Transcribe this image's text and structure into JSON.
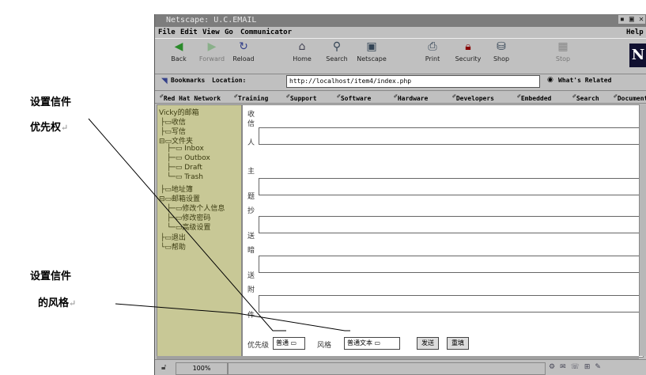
{
  "annotations": [
    {
      "line1": "设置信件",
      "line2": "优先权"
    },
    {
      "line1": "设置信件",
      "line2": "的风格"
    }
  ],
  "annotation_mark": "↵",
  "window": {
    "title": "Netscape: U.C.EMAIL",
    "menu": [
      "File",
      "Edit",
      "View",
      "Go",
      "Communicator"
    ],
    "menu_right": "Help"
  },
  "toolbar": [
    {
      "icon": "back-icon",
      "label": "Back"
    },
    {
      "icon": "forward-icon",
      "label": "Forward"
    },
    {
      "icon": "reload-icon",
      "label": "Reload"
    },
    {
      "icon": "home-icon",
      "label": "Home"
    },
    {
      "icon": "search-icon",
      "label": "Search"
    },
    {
      "icon": "netscape-icon",
      "label": "Netscape"
    },
    {
      "icon": "print-icon",
      "label": "Print"
    },
    {
      "icon": "security-icon",
      "label": "Security"
    },
    {
      "icon": "shop-icon",
      "label": "Shop"
    },
    {
      "icon": "stop-icon",
      "label": "Stop"
    }
  ],
  "location": {
    "bookmarks_label": "Bookmarks",
    "location_label": "Location:",
    "url": "http://localhost/item4/index.php",
    "related_label": "What's Related"
  },
  "personal_bar": [
    "Red Hat Network",
    "Training",
    "Support",
    "Software",
    "Hardware",
    "Developers",
    "Embedded",
    "Search",
    "Documentation"
  ],
  "tree": [
    "Vicky的邮箱",
    "收信",
    "写信",
    "文件夹",
    "Inbox",
    "Outbox",
    "Draft",
    "Trash",
    "地址簿",
    "邮箱设置",
    "修改个人信息",
    "修改密码",
    "高级设置",
    "退出",
    "帮助"
  ],
  "form": {
    "recipient_label": [
      "收",
      "信",
      "人"
    ],
    "subject_label": [
      "主",
      "题"
    ],
    "cc_label": [
      "抄",
      "送"
    ],
    "bcc_label": [
      "暗",
      "送"
    ],
    "attach_label": [
      "附",
      "件"
    ],
    "priority_label": "优先级",
    "priority_value": "普通",
    "style_label": "风格",
    "style_value": "普通文本",
    "send_button": "发送",
    "reset_button": "重填"
  },
  "status": {
    "zoom": "100%"
  }
}
